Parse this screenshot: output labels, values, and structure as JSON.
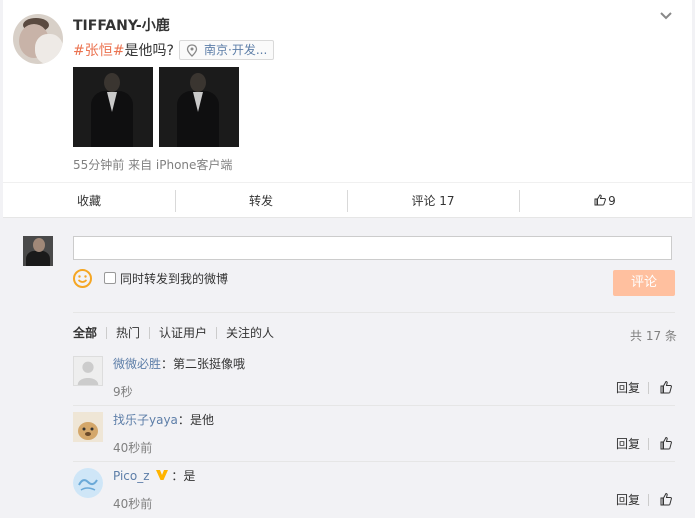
{
  "post": {
    "user_name": "TIFFANY-小鹿",
    "hashtag": "#张恒#",
    "text": "是他吗?",
    "location": "南京·开发...",
    "meta": "55分钟前 来自 iPhone客户端"
  },
  "actions": {
    "favorite": "收藏",
    "repost": "转发",
    "comment": "评论 17",
    "like_count": "9"
  },
  "composer": {
    "input_value": "",
    "repost_checkbox_label": "同时转发到我的微博",
    "submit_label": "评论"
  },
  "filters": {
    "items": [
      "全部",
      "热门",
      "认证用户",
      "关注的人"
    ],
    "total": "共 17 条"
  },
  "comments": [
    {
      "name": "微微必胜",
      "sep": "：",
      "text": "第二张挺像哦",
      "time": "9秒",
      "reply": "回复"
    },
    {
      "name": "找乐子yaya",
      "sep": "：",
      "text": "是他",
      "time": "40秒前",
      "reply": "回复"
    },
    {
      "name": "Pico_z",
      "sep": "：",
      "text": "是",
      "time": "40秒前",
      "reply": "回复"
    }
  ],
  "icons": {
    "collapse": "chevron-down-icon",
    "location": "location-pin-icon",
    "like": "thumbs-up-icon",
    "emoji": "smiley-icon",
    "verified": "vip-badge-icon"
  },
  "colors": {
    "accent": "#eb7350",
    "link": "#5d7ea8",
    "submit_disabled": "#ffc09f",
    "badge": "#ffb400"
  }
}
